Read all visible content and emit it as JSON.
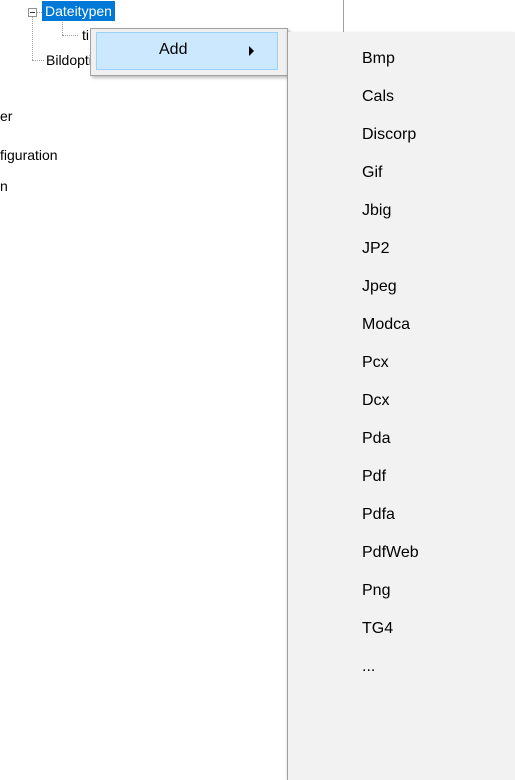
{
  "tree": {
    "selected_node": "Dateitypen",
    "child_partial": "ti",
    "sibling_node": "Bildoptimierung",
    "cut_nodes": [
      "er",
      "figuration",
      "n"
    ]
  },
  "context_menu": {
    "add_label": "Add"
  },
  "submenu": {
    "items": [
      "Bmp",
      "Cals",
      "Discorp",
      "Gif",
      "Jbig",
      "JP2",
      "Jpeg",
      "Modca",
      "Pcx",
      "Dcx",
      "Pda",
      "Pdf",
      "Pdfa",
      "PdfWeb",
      "Png",
      "TG4",
      "..."
    ]
  },
  "colors": {
    "selection": "#0078d7",
    "menu_highlight": "#cce8ff",
    "menu_border": "#a0a0a0"
  }
}
